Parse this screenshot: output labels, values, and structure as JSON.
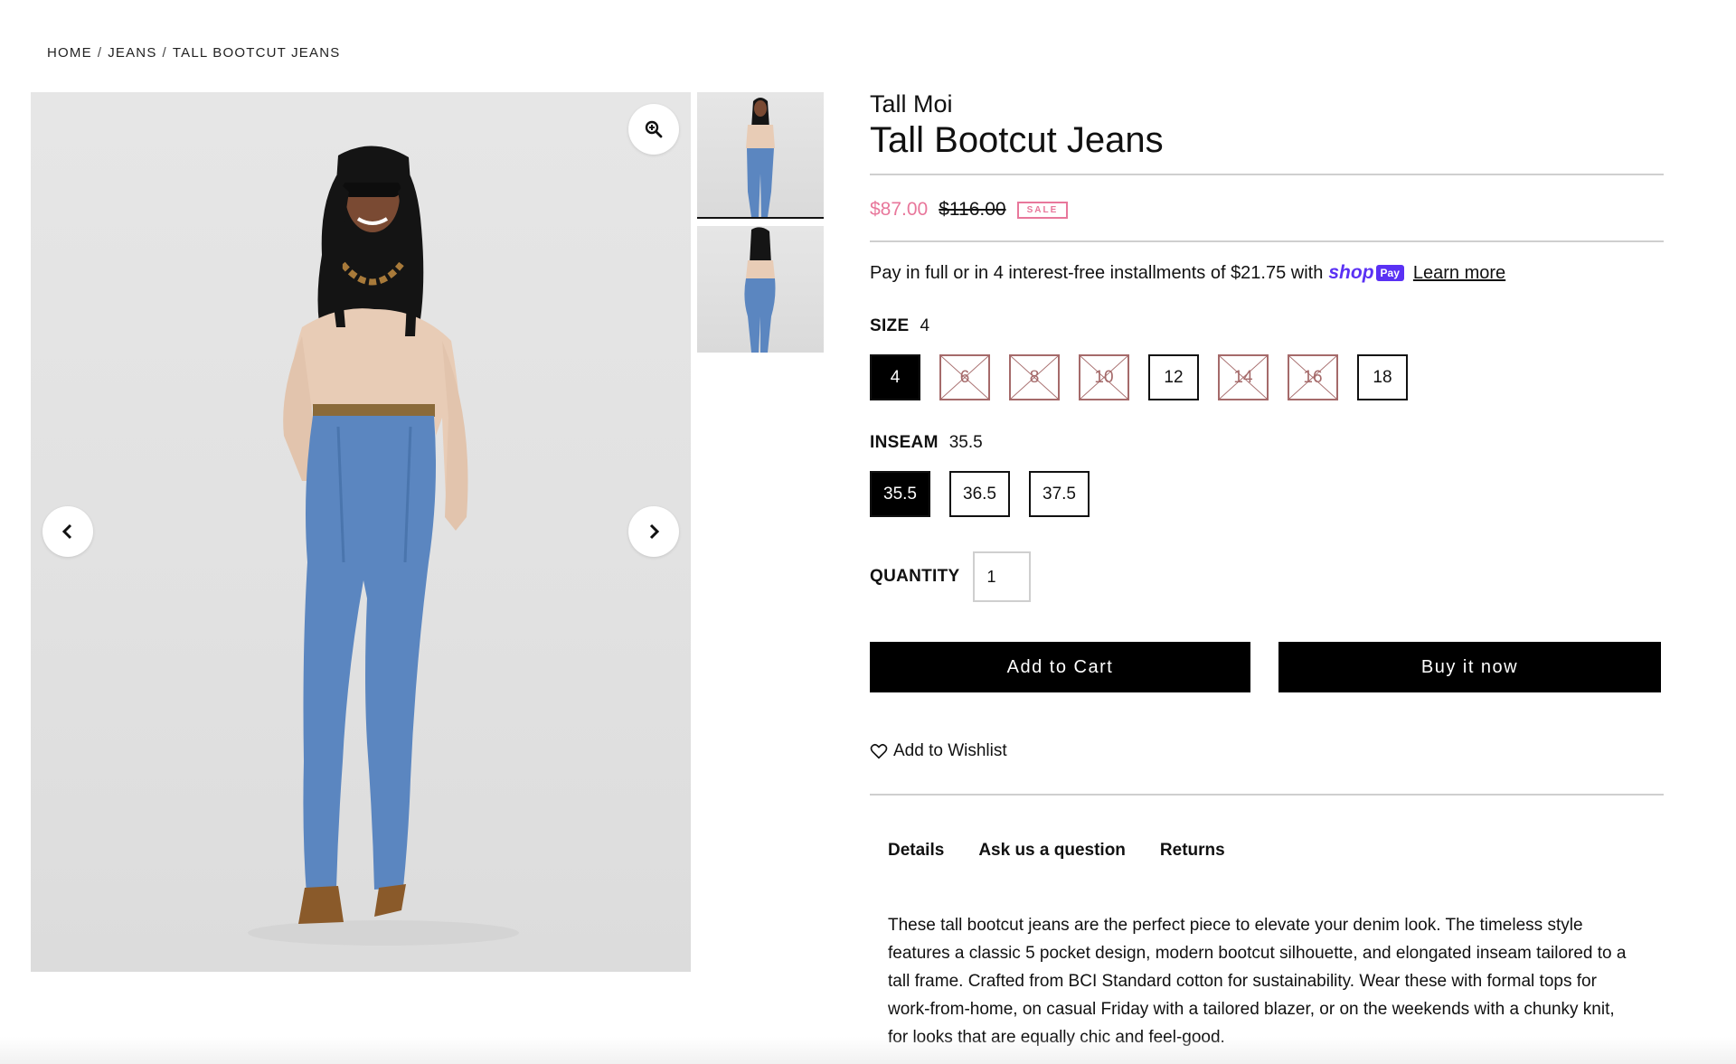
{
  "breadcrumb": [
    "HOME",
    "JEANS",
    "TALL BOOTCUT JEANS"
  ],
  "breadcrumb_sep": "/",
  "product": {
    "brand": "Tall Moi",
    "title": "Tall Bootcut Jeans",
    "sale_price": "$87.00",
    "original_price": "$116.00",
    "badge": "SALE"
  },
  "installments": {
    "text": "Pay in full or in 4 interest-free installments of $21.75 with",
    "shop_text": "shop",
    "pay_text": "Pay",
    "learn_more": "Learn more"
  },
  "size": {
    "label": "SIZE",
    "selected": "4",
    "options": [
      {
        "label": "4",
        "state": "selected"
      },
      {
        "label": "6",
        "state": "unavailable"
      },
      {
        "label": "8",
        "state": "unavailable"
      },
      {
        "label": "10",
        "state": "unavailable"
      },
      {
        "label": "12",
        "state": "available"
      },
      {
        "label": "14",
        "state": "unavailable"
      },
      {
        "label": "16",
        "state": "unavailable"
      },
      {
        "label": "18",
        "state": "available"
      }
    ]
  },
  "inseam": {
    "label": "INSEAM",
    "selected": "35.5",
    "options": [
      {
        "label": "35.5",
        "state": "selected"
      },
      {
        "label": "36.5",
        "state": "available"
      },
      {
        "label": "37.5",
        "state": "available"
      }
    ]
  },
  "quantity": {
    "label": "QUANTITY",
    "value": "1"
  },
  "buttons": {
    "add_to_cart": "Add to Cart",
    "buy_now": "Buy it now"
  },
  "wishlist": "Add to Wishlist",
  "tabs": [
    "Details",
    "Ask us a question",
    "Returns"
  ],
  "description": "These tall bootcut jeans are the perfect piece to elevate your denim look. The timeless style features a classic 5 pocket design, modern bootcut silhouette, and elongated inseam tailored to a tall frame. Crafted from BCI Standard cotton for sustainability. Wear these with formal tops for work-from-home, on casual Friday with a tailored blazer, or on the weekends with a chunky knit, for looks that are equally chic and feel-good.",
  "icons": {
    "zoom": "zoom-in-icon",
    "prev": "chevron-left-icon",
    "next": "chevron-right-icon",
    "wishlist": "heart-icon"
  },
  "colors": {
    "sale": "#e8779b",
    "shop_pay": "#5a31f4",
    "unavailable": "#a56a6a"
  }
}
